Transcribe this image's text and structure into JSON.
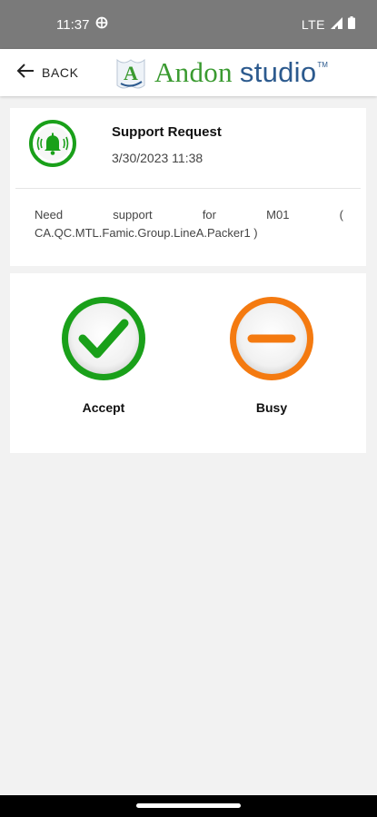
{
  "status_bar": {
    "time": "11:37",
    "network": "LTE",
    "icons": [
      "sync-circle-icon",
      "signal-icon",
      "battery-icon"
    ]
  },
  "app_bar": {
    "back_label": "BACK",
    "logo": {
      "mark_letter": "A",
      "word1": "Andon",
      "word2": "studio",
      "tm": "TM"
    },
    "colors": {
      "logo_green": "#3a9a30",
      "logo_blue": "#2c5a8e"
    }
  },
  "request": {
    "icon": "alarm-bell-icon",
    "title": "Support Request",
    "timestamp": "3/30/2023 11:38",
    "message": "Need support for M01 ( CA.QC.MTL.Famic.Group.LineA.Packer1 )"
  },
  "actions": {
    "accept": {
      "label": "Accept",
      "icon": "checkmark-icon",
      "color": "#1aa01a"
    },
    "busy": {
      "label": "Busy",
      "icon": "minus-icon",
      "color": "#f47a10"
    }
  }
}
